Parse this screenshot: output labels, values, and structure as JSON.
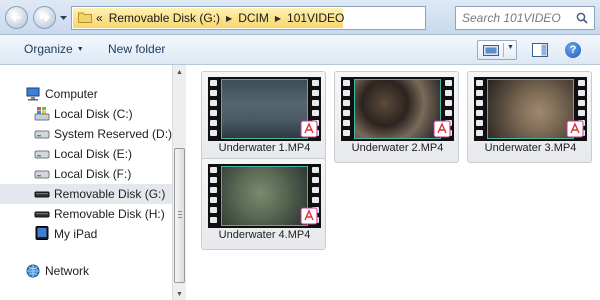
{
  "address": {
    "crumbs": [
      "Removable Disk (G:)",
      "DCIM",
      "101VIDEO"
    ],
    "chevron": "«",
    "highlight_color": "#f8dc7a"
  },
  "search": {
    "placeholder": "Search 101VIDEO"
  },
  "toolbar": {
    "organize_label": "Organize",
    "new_folder_label": "New folder",
    "help_label": "?"
  },
  "sidebar": {
    "items": [
      {
        "label": "Computer",
        "icon": "computer-icon"
      },
      {
        "label": "Local Disk (C:)",
        "icon": "windows-drive-icon"
      },
      {
        "label": "System Reserved (D:)",
        "icon": "drive-icon"
      },
      {
        "label": "Local Disk (E:)",
        "icon": "drive-icon"
      },
      {
        "label": "Local Disk (F:)",
        "icon": "drive-icon"
      },
      {
        "label": "Removable Disk (G:)",
        "icon": "removable-drive-icon",
        "selected": true
      },
      {
        "label": "Removable Disk (H:)",
        "icon": "removable-drive-icon"
      },
      {
        "label": "My iPad",
        "icon": "ipad-icon"
      },
      {
        "label": "Network",
        "icon": "network-icon"
      }
    ]
  },
  "files": [
    {
      "name": "Underwater 1.MP4",
      "icon": "video-file-icon"
    },
    {
      "name": "Underwater 2.MP4",
      "icon": "video-file-icon"
    },
    {
      "name": "Underwater 3.MP4",
      "icon": "video-file-icon"
    },
    {
      "name": "Underwater 4.MP4",
      "icon": "video-file-icon"
    }
  ],
  "colors": {
    "selection": "#e4e8ee",
    "link_text": "#1e395b",
    "frame_accent": "#44b5a0"
  }
}
